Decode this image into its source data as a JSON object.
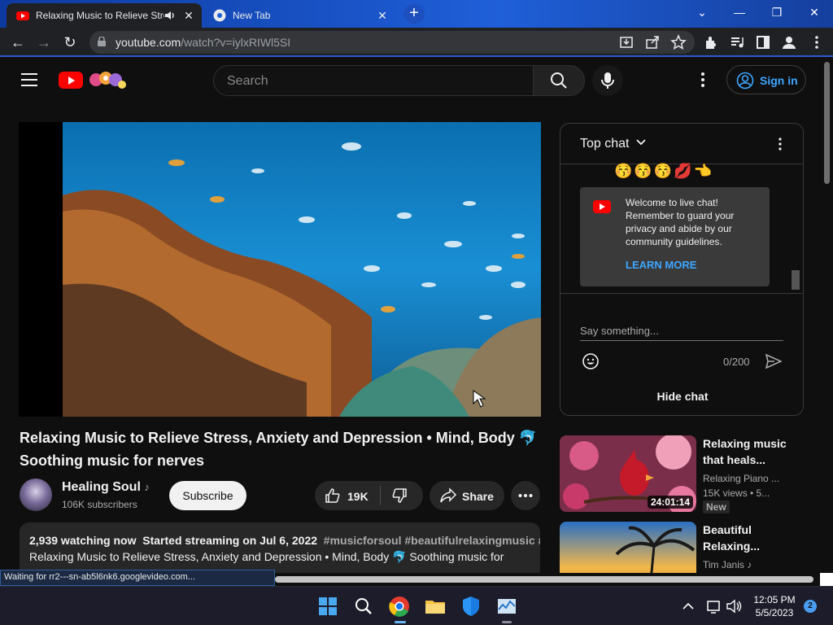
{
  "browser": {
    "tabs": [
      {
        "title": "Relaxing Music to Relieve Stress",
        "icon": "youtube-icon",
        "audio": true
      },
      {
        "title": "New Tab",
        "icon": "chrome-icon"
      }
    ],
    "url_host": "youtube.com",
    "url_path": "/watch?v=iylxRIWl5SI",
    "status": "Waiting for rr2---sn-ab5l6nk6.googlevideo.com..."
  },
  "header": {
    "search_placeholder": "Search",
    "signin_label": "Sign in"
  },
  "video": {
    "title": "Relaxing Music to Relieve Stress, Anxiety and Depression • Mind, Body 🐬 Soothing music for nerves",
    "channel": "Healing Soul",
    "subscribers": "106K subscribers",
    "subscribe_label": "Subscribe",
    "likes": "19K",
    "share_label": "Share",
    "description": {
      "watching": "2,939 watching now",
      "started": "Started streaming on Jul 6, 2022",
      "tags": "#musicforsoul #beautifulrelaxingmusic #r",
      "line2": "Relaxing Music to Relieve Stress, Anxiety and Depression • Mind, Body 🐬 Soothing music for"
    }
  },
  "chat": {
    "title": "Top chat",
    "emojis": "😚😚😚💋👈",
    "welcome": "Welcome to live chat! Remember to guard your privacy and abide by our community guidelines.",
    "learn_more": "LEARN MORE",
    "input_placeholder": "Say something...",
    "char_count": "0/200",
    "hide_label": "Hide chat"
  },
  "related": [
    {
      "title": "Relaxing music that heals...",
      "channel": "Relaxing Piano ...",
      "meta": "15K views • 5...",
      "duration": "24:01:14",
      "badge": "New"
    },
    {
      "title": "Beautiful Relaxing...",
      "channel": "Tim Janis"
    }
  ],
  "taskbar": {
    "time": "12:05 PM",
    "date": "5/5/2023",
    "notifications": "2"
  },
  "colors": {
    "youtube_red": "#ff0000",
    "link_blue": "#3ea6ff",
    "background": "#0f0f0f",
    "chrome_accent": "#1f5fd8"
  }
}
